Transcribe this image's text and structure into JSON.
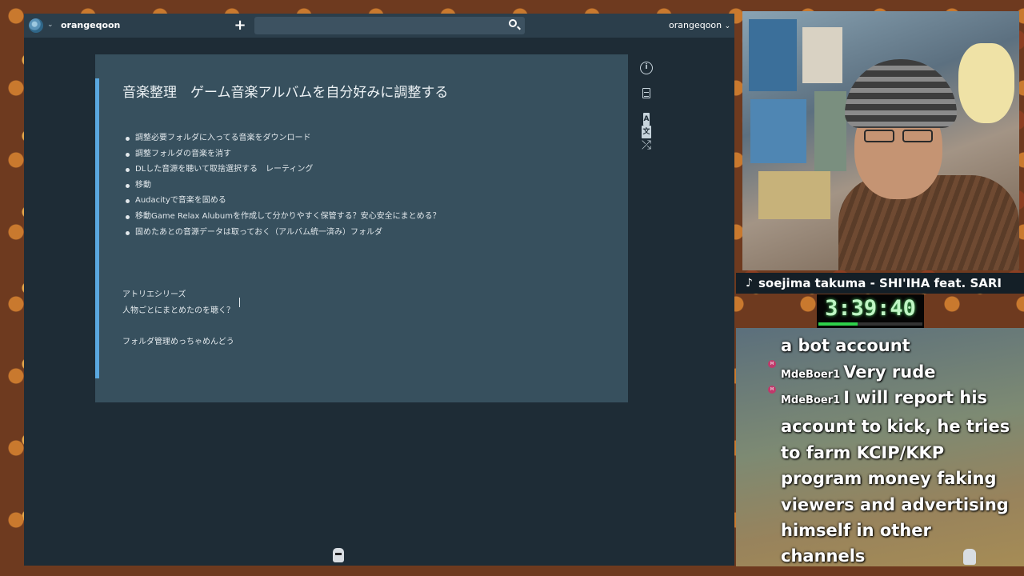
{
  "app": {
    "username_left": "orangeqoon",
    "username_right": "orangeqoon",
    "search_placeholder": ""
  },
  "note": {
    "title": "音楽整理　ゲーム音楽アルバムを自分好みに調整する",
    "bullets": [
      "調整必要フォルダに入ってる音楽をダウンロード",
      "調整フォルダの音楽を消す",
      "DLした音源を聴いて取捨選択する　レーティング",
      "移動",
      "Audacityで音楽を固める",
      "移動Game Relax Alubumを作成して分かりやすく保管する？安心安全にまとめる？",
      "固めたあとの音源データは取っておく（アルバム統一済み）フォルダ"
    ],
    "para1": "アトリエシリーズ",
    "para2": "人物ごとにまとめたのを聴く？",
    "para3": "フォルダ管理めっちゃめんどう"
  },
  "side_icons": [
    "info-icon",
    "document-icon",
    "translate-icon",
    "shuffle-icon"
  ],
  "stream": {
    "now_playing": "soejima takuma - SHI'IHA feat. SARI",
    "timer": "3:39:40",
    "timer_progress": 0.38,
    "chat": [
      {
        "user": "",
        "message": "a bot account"
      },
      {
        "user": "MdeBoer1",
        "message": "Very rude"
      },
      {
        "user": "MdeBoer1",
        "message": "I will report his account to kick, he tries to farm KCIP/KKP program money faking viewers and advertising himself in other channels"
      }
    ]
  },
  "colors": {
    "topbar": "#2b3e4b",
    "app_bg": "#1e2c36",
    "note_bg": "#37505e",
    "note_accent": "#5aa8e0",
    "timer_green": "#2fd14b"
  }
}
